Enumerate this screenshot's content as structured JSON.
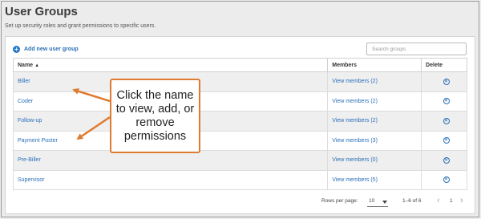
{
  "header": {
    "title": "User Groups",
    "subtitle": "Set up security roles and grant permissions to specific users."
  },
  "toolbar": {
    "add_label": "Add new user group",
    "search_placeholder": "Search groups"
  },
  "table": {
    "columns": {
      "name": "Name",
      "members": "Members",
      "delete": "Delete"
    },
    "sort_indicator": "▲",
    "rows": [
      {
        "name": "Biller",
        "members": "View members (2)"
      },
      {
        "name": "Coder",
        "members": "View members (2)"
      },
      {
        "name": "Follow-up",
        "members": "View members (2)"
      },
      {
        "name": "Payment Poster",
        "members": "View members (3)"
      },
      {
        "name": "Pre-Biller",
        "members": "View members (0)"
      },
      {
        "name": "Supervisor",
        "members": "View members (5)"
      }
    ]
  },
  "pagination": {
    "rows_per_page_label": "Rows per page:",
    "rows_per_page_value": "10",
    "range": "1–6 of 6",
    "current_page": "1",
    "prev_icon": "‹",
    "next_icon": "›"
  },
  "callout": {
    "text": "Click the name to view, add, or remove permissions"
  },
  "colors": {
    "link": "#2a6fb8",
    "callout_border": "#e07a2e",
    "arrow": "#e07a2e"
  },
  "icons": {
    "add": "plus-circle-icon",
    "delete": "x-circle-icon",
    "sort": "sort-ascending-icon",
    "prev": "chevron-left-icon",
    "next": "chevron-right-icon"
  }
}
